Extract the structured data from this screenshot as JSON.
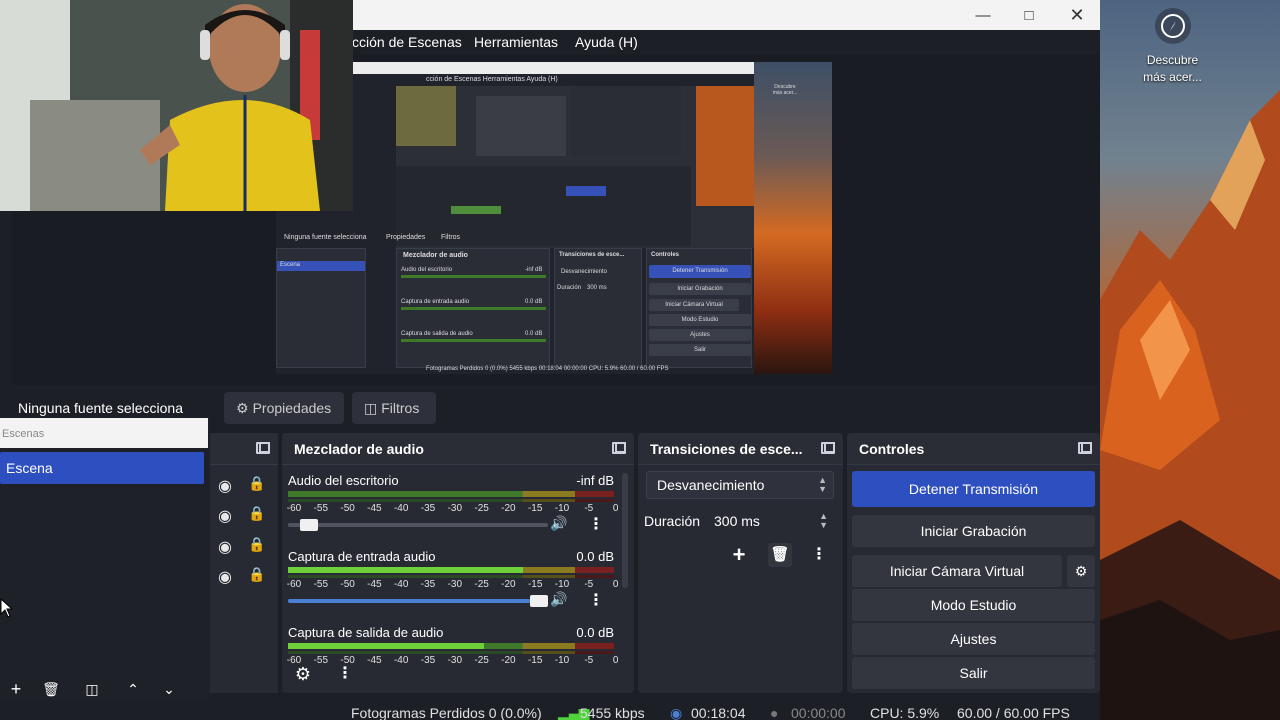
{
  "menu": {
    "items": [
      "cción de Escenas",
      "Herramientas",
      "Ayuda (H)"
    ]
  },
  "desktop": {
    "icon_label": "Descubre más acer..."
  },
  "preview_capture": {
    "menu": "cción de Escenas   Herramientas   Ayuda (H)",
    "no_source": "Ninguna fuente selecciona",
    "properties": "Propiedades",
    "filters": "Filtros",
    "scene": "Escena",
    "mixer_title": "Mezclador de audio",
    "transitions_title": "Transiciones de esce...",
    "controls_title": "Controles",
    "ch1": "Audio del escritorio",
    "ch1_db": "-inf dB",
    "ch2": "Captura de entrada audio",
    "ch2_db": "0.0 dB",
    "ch3": "Captura de salida de audio",
    "ch3_db": "0.0 dB",
    "fade": "Desvanecimiento",
    "duration": "Duración",
    "duration_val": "300 ms",
    "btn_stop": "Detener Transmisión",
    "btn_record": "Iniciar Grabación",
    "btn_vcam": "Iniciar Cámara Virtual",
    "btn_studio": "Modo Estudio",
    "btn_settings": "Ajustes",
    "btn_exit": "Salir",
    "status": "Fotogramas Perdidos 0 (0.0%)   5455 kbps   00:18:04   00:00:00   CPU: 5.9%   60.00 / 60.00 FPS",
    "desk_label": "Descubre más acer..."
  },
  "source_bar": {
    "no_source": "Ninguna fuente selecciona",
    "properties": "Propiedades",
    "filters": "Filtros"
  },
  "scenes": {
    "header": "Escenas",
    "items": [
      "Escena"
    ]
  },
  "mixer": {
    "title": "Mezclador de audio",
    "ticks": [
      "-60",
      "-55",
      "-50",
      "-45",
      "-40",
      "-35",
      "-30",
      "-25",
      "-20",
      "-15",
      "-10",
      "-5",
      "0"
    ],
    "channels": [
      {
        "name": "Audio del escritorio",
        "db": "-inf dB",
        "level": 0.0,
        "volume": 0.05
      },
      {
        "name": "Captura de entrada audio",
        "db": "0.0 dB",
        "level": 0.72,
        "volume": 1.0
      },
      {
        "name": "Captura de salida de audio",
        "db": "0.0 dB",
        "level": 0.6,
        "volume": 1.0
      }
    ]
  },
  "transitions": {
    "title": "Transiciones de esce...",
    "selected": "Desvanecimiento",
    "duration_label": "Duración",
    "duration_value": "300 ms"
  },
  "controls": {
    "title": "Controles",
    "stop_stream": "Detener Transmisión",
    "start_recording": "Iniciar Grabación",
    "start_virtual_cam": "Iniciar Cámara Virtual",
    "studio_mode": "Modo Estudio",
    "settings": "Ajustes",
    "exit": "Salir"
  },
  "status": {
    "dropped": "Fotogramas Perdidos 0 (0.0%)",
    "bitrate": "5455 kbps",
    "stream_time": "00:18:04",
    "record_time": "00:00:00",
    "cpu": "CPU: 5.9%",
    "fps": "60.00 / 60.00 FPS"
  },
  "colors": {
    "accent": "#2e4fc0",
    "panel": "#272a33",
    "background": "#1d1f26",
    "meter_green": "#6ed13a"
  }
}
